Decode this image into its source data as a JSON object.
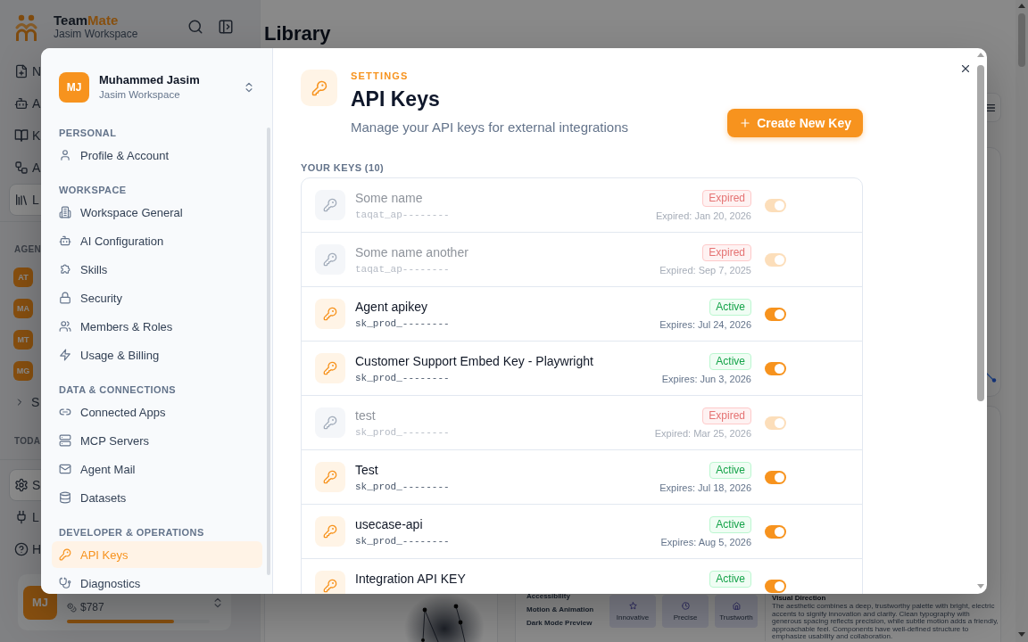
{
  "app_sidebar": {
    "brand_parts": [
      "Team",
      "Mate"
    ],
    "workspace": "Jasim Workspace",
    "nav": [
      {
        "label": "N",
        "selected": false
      },
      {
        "label": "A",
        "selected": false
      },
      {
        "label": "K",
        "selected": false
      },
      {
        "label": "A",
        "selected": false
      },
      {
        "label": "L",
        "selected": true
      }
    ],
    "agents_heading": "AGEN",
    "agents": [
      {
        "initials": "AT"
      },
      {
        "initials": "MA"
      },
      {
        "initials": "MT"
      },
      {
        "initials": "MG"
      }
    ],
    "group": "S",
    "today_heading": "TODA",
    "footer_nav": [
      {
        "label": "S",
        "selected": true
      },
      {
        "label": "L",
        "selected": false
      },
      {
        "label": "H",
        "selected": false
      }
    ],
    "user": {
      "initials": "MJ",
      "credits": "$787",
      "level": 0.75
    }
  },
  "page": {
    "title": "Library",
    "preview": {
      "settings": [
        "Accessibility",
        "Motion & Animation",
        "Dark Mode Preview"
      ],
      "traits": [
        "Innovative",
        "Precise",
        "Trustworth"
      ],
      "direction_title": "Visual Direction",
      "direction_text": "The aesthetic combines a deep, trustworthy palette with bright, electric accents to signify innovation and clarity. Clean typography with generous spacing reflects precision, while subtle motion adds a friendly, approachable feel. Components have well-defined structure to emphasize usability and collaboration."
    }
  },
  "settings_dialog": {
    "account": {
      "initials": "MJ",
      "name": "Muhammed Jasim",
      "workspace": "Jasim Workspace"
    },
    "sections": [
      {
        "heading": "PERSONAL",
        "items": [
          {
            "label": "Profile & Account",
            "selected": false
          }
        ]
      },
      {
        "heading": "WORKSPACE",
        "items": [
          {
            "label": "Workspace General",
            "selected": false
          },
          {
            "label": "AI Configuration",
            "selected": false
          },
          {
            "label": "Skills",
            "selected": false
          },
          {
            "label": "Security",
            "selected": false
          },
          {
            "label": "Members & Roles",
            "selected": false
          },
          {
            "label": "Usage & Billing",
            "selected": false
          }
        ]
      },
      {
        "heading": "DATA & CONNECTIONS",
        "items": [
          {
            "label": "Connected Apps",
            "selected": false
          },
          {
            "label": "MCP Servers",
            "selected": false
          },
          {
            "label": "Agent Mail",
            "selected": false
          },
          {
            "label": "Datasets",
            "selected": false
          }
        ]
      },
      {
        "heading": "DEVELOPER & OPERATIONS",
        "items": [
          {
            "label": "API Keys",
            "selected": true
          },
          {
            "label": "Diagnostics",
            "selected": false
          }
        ]
      }
    ],
    "eyebrow": "SETTINGS",
    "title": "API Keys",
    "description": "Manage your API keys for external integrations",
    "create_button": "Create New Key",
    "keys_heading": "YOUR KEYS (10)",
    "keys": [
      {
        "name": "Some name",
        "prefix": "taqat_ap--------",
        "status": "Expired",
        "expired": true,
        "date": "Expired: Jan 20, 2026",
        "enabled": true
      },
      {
        "name": "Some name another",
        "prefix": "taqat_ap--------",
        "status": "Expired",
        "expired": true,
        "date": "Expired: Sep 7, 2025",
        "enabled": true
      },
      {
        "name": "Agent apikey",
        "prefix": "sk_prod_--------",
        "status": "Active",
        "expired": false,
        "date": "Expires: Jul 24, 2026",
        "enabled": true
      },
      {
        "name": "Customer Support Embed Key - Playwright",
        "prefix": "sk_prod_--------",
        "status": "Active",
        "expired": false,
        "date": "Expires: Jun 3, 2026",
        "enabled": true
      },
      {
        "name": "test",
        "prefix": "sk_prod_--------",
        "status": "Expired",
        "expired": true,
        "date": "Expired: Mar 25, 2026",
        "enabled": true
      },
      {
        "name": "Test",
        "prefix": "sk_prod_--------",
        "status": "Active",
        "expired": false,
        "date": "Expires: Jul 18, 2026",
        "enabled": true
      },
      {
        "name": "usecase-api",
        "prefix": "sk_prod_--------",
        "status": "Active",
        "expired": false,
        "date": "Expires: Aug 5, 2026",
        "enabled": true
      },
      {
        "name": "Integration API KEY",
        "status": "Active",
        "expired": false,
        "enabled": true
      }
    ]
  }
}
